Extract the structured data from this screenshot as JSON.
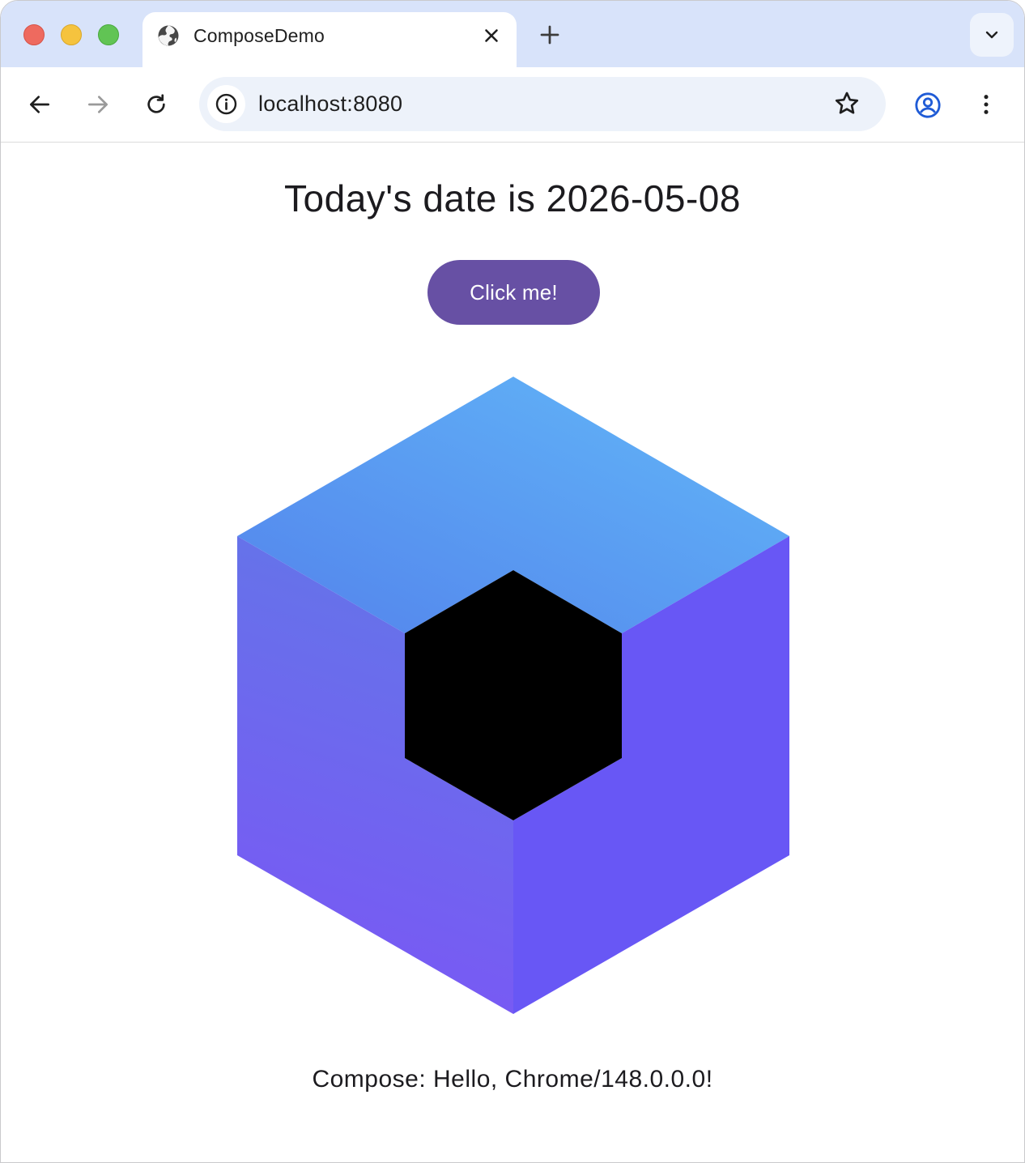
{
  "browser": {
    "tab": {
      "title": "ComposeDemo",
      "favicon_icon": "globe-icon"
    },
    "toolbar": {
      "url": "localhost:8080",
      "icons": [
        "back-arrow-icon",
        "forward-arrow-icon",
        "reload-icon",
        "info-icon",
        "star-icon",
        "profile-icon",
        "more-vert-icon"
      ]
    },
    "colors": {
      "tabstrip_bg": "#d8e3fa",
      "omnibox_bg": "#edf2fa",
      "profile_accent": "#1f5bd6"
    }
  },
  "page": {
    "date_text": "Today's date is 2026-05-08",
    "button_label": "Click me!",
    "greeting": "Compose: Hello, Chrome/148.0.0.0!",
    "colors": {
      "button_bg": "#6750a4",
      "logo_top_start": "#5383ec",
      "logo_top_end": "#62b8f8",
      "logo_left_start": "#6376e8",
      "logo_left_end": "#7a57f5",
      "logo_right": "#6857f5",
      "logo_center": "#000000"
    }
  }
}
